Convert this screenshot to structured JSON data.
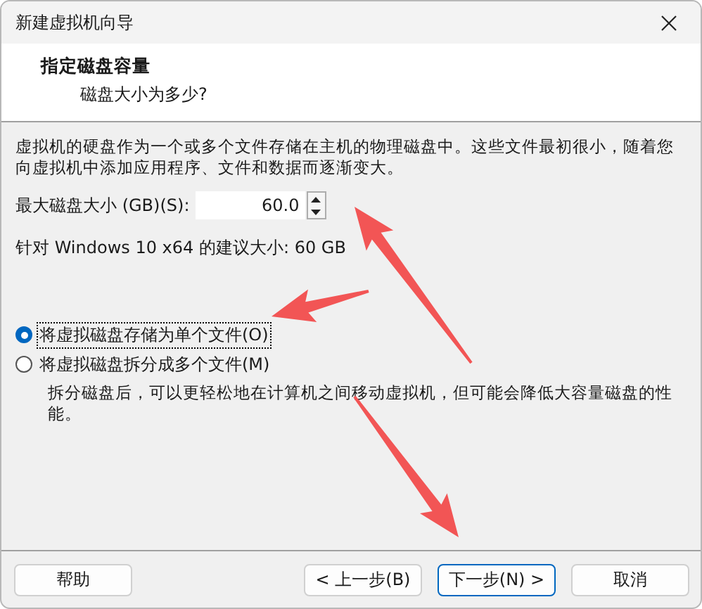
{
  "window": {
    "title": "新建虚拟机向导"
  },
  "header": {
    "title": "指定磁盘容量",
    "subtitle": "磁盘大小为多少?"
  },
  "intro": "虚拟机的硬盘作为一个或多个文件存储在主机的物理磁盘中。这些文件最初很小，随着您向虚拟机中添加应用程序、文件和数据而逐渐变大。",
  "disk_size": {
    "label": "最大磁盘大小 (GB)(S):",
    "value": "60.0"
  },
  "recommendation": "针对 Windows 10 x64 的建议大小: 60 GB",
  "options": [
    {
      "label": "将虚拟磁盘存储为单个文件(O)",
      "selected": true
    },
    {
      "label": "将虚拟磁盘拆分成多个文件(M)",
      "selected": false,
      "note": "拆分磁盘后，可以更轻松地在计算机之间移动虚拟机，但可能会降低大容量磁盘的性能。"
    }
  ],
  "buttons": [
    {
      "label": "帮助",
      "default": false,
      "kind": "help"
    },
    {
      "label": "< 上一步(B)",
      "default": false,
      "kind": "nav"
    },
    {
      "label": "下一步(N) >",
      "default": true,
      "kind": "nav"
    },
    {
      "label": "取消",
      "default": false,
      "kind": "nav"
    }
  ]
}
